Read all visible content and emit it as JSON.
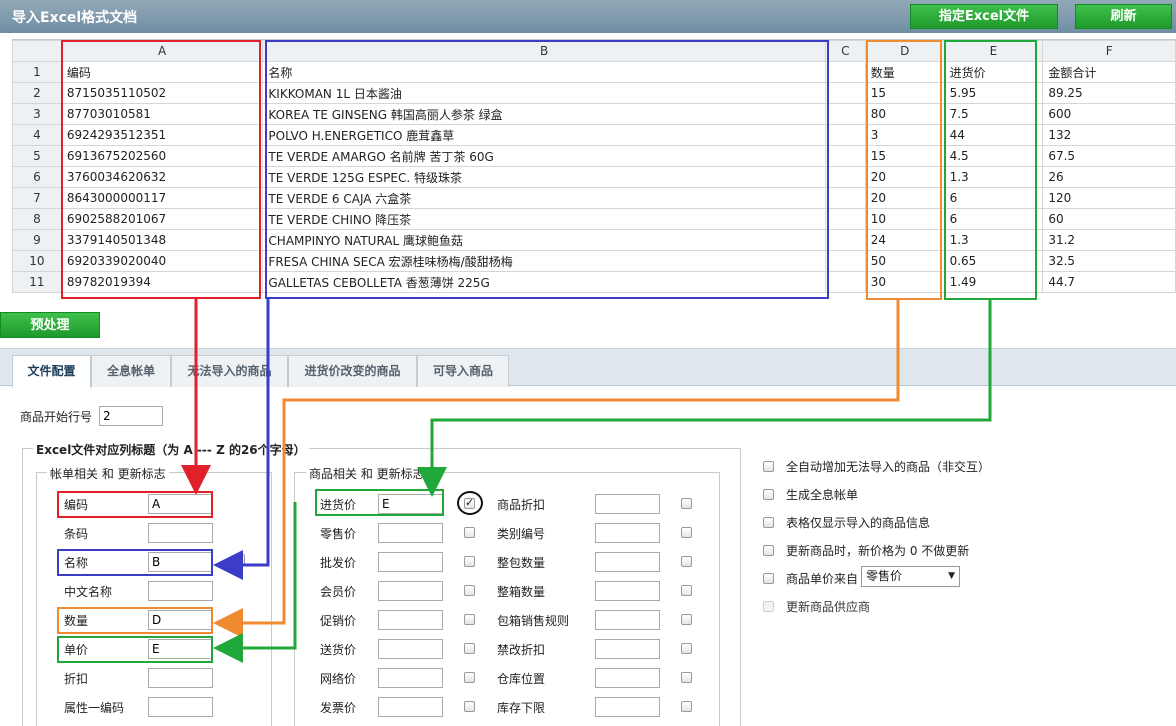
{
  "window_title": "导入Excel格式文档",
  "toolbar": {
    "specify_excel": "指定Excel文件",
    "refresh": "刷新"
  },
  "sheet": {
    "columns": [
      "A",
      "B",
      "C",
      "D",
      "E",
      "F"
    ],
    "rows": [
      {
        "n": "1",
        "a": "编码",
        "b": "名称",
        "c": "",
        "d": "数量",
        "e": "进货价",
        "f": "金额合计"
      },
      {
        "n": "2",
        "a": "8715035110502",
        "b": "KIKKOMAN 1L 日本酱油",
        "c": "",
        "d": "15",
        "e": "5.95",
        "f": "89.25"
      },
      {
        "n": "3",
        "a": "87703010581",
        "b": "KOREA TE GINSENG 韩国高丽人参茶 绿盒",
        "c": "",
        "d": "80",
        "e": "7.5",
        "f": "600"
      },
      {
        "n": "4",
        "a": "6924293512351",
        "b": "POLVO H.ENERGETICO 鹿茸鑫草",
        "c": "",
        "d": "3",
        "e": "44",
        "f": "132"
      },
      {
        "n": "5",
        "a": "6913675202560",
        "b": "TE VERDE AMARGO 名前牌 苦丁茶 60G",
        "c": "",
        "d": "15",
        "e": "4.5",
        "f": "67.5"
      },
      {
        "n": "6",
        "a": "3760034620632",
        "b": "TE VERDE 125G ESPEC. 特级珠茶",
        "c": "",
        "d": "20",
        "e": "1.3",
        "f": "26"
      },
      {
        "n": "7",
        "a": "8643000000117",
        "b": "TE VERDE 6 CAJA 六盒茶",
        "c": "",
        "d": "20",
        "e": "6",
        "f": "120"
      },
      {
        "n": "8",
        "a": "6902588201067",
        "b": "TE VERDE CHINO 降压茶",
        "c": "",
        "d": "10",
        "e": "6",
        "f": "60"
      },
      {
        "n": "9",
        "a": "3379140501348",
        "b": "CHAMPINYO NATURAL 鹰球鲍鱼菇",
        "c": "",
        "d": "24",
        "e": "1.3",
        "f": "31.2"
      },
      {
        "n": "10",
        "a": "6920339020040",
        "b": "FRESA CHINA SECA 宏源桂味杨梅/酸甜杨梅",
        "c": "",
        "d": "50",
        "e": "0.65",
        "f": "32.5"
      },
      {
        "n": "11",
        "a": "89782019394",
        "b": "GALLETAS CEBOLLETA 香葱薄饼 225G",
        "c": "",
        "d": "30",
        "e": "1.49",
        "f": "44.7"
      }
    ]
  },
  "preprocess_label": "预处理",
  "tabs": [
    "文件配置",
    "全息帐单",
    "无法导入的商品",
    "进货价改变的商品",
    "可导入商品"
  ],
  "start_row": {
    "label": "商品开始行号",
    "value": "2"
  },
  "excel_group_title": "Excel文件对应列标题（为 A --- Z 的26个字母）",
  "account_group": {
    "title": "帐单相关 和 更新标志",
    "fields": [
      {
        "label": "编码",
        "value": "A"
      },
      {
        "label": "条码",
        "value": ""
      },
      {
        "label": "名称",
        "value": "B"
      },
      {
        "label": "中文名称",
        "value": ""
      },
      {
        "label": "数量",
        "value": "D"
      },
      {
        "label": "单价",
        "value": "E"
      },
      {
        "label": "折扣",
        "value": ""
      },
      {
        "label": "属性一编码",
        "value": ""
      }
    ]
  },
  "product_group": {
    "title": "商品相关 和 更新标志",
    "left": [
      {
        "label": "进货价",
        "value": "E",
        "checked": true
      },
      {
        "label": "零售价",
        "value": "",
        "checked": false
      },
      {
        "label": "批发价",
        "value": "",
        "checked": false
      },
      {
        "label": "会员价",
        "value": "",
        "checked": false
      },
      {
        "label": "促销价",
        "value": "",
        "checked": false
      },
      {
        "label": "送货价",
        "value": "",
        "checked": false
      },
      {
        "label": "网络价",
        "value": "",
        "checked": false
      },
      {
        "label": "发票价",
        "value": "",
        "checked": false
      }
    ],
    "right": [
      {
        "label": "商品折扣",
        "value": ""
      },
      {
        "label": "类别编号",
        "value": ""
      },
      {
        "label": "整包数量",
        "value": ""
      },
      {
        "label": "整箱数量",
        "value": ""
      },
      {
        "label": "包箱销售规则",
        "value": ""
      },
      {
        "label": "禁改折扣",
        "value": ""
      },
      {
        "label": "仓库位置",
        "value": ""
      },
      {
        "label": "库存下限",
        "value": ""
      }
    ]
  },
  "options": [
    {
      "label": "全自动增加无法导入的商品（非交互）"
    },
    {
      "label": "生成全息帐单"
    },
    {
      "label": "表格仅显示导入的商品信息"
    },
    {
      "label": "更新商品时，新价格为 0 不做更新"
    },
    {
      "label": "商品单价来自"
    },
    {
      "label": "更新商品供应商"
    }
  ],
  "price_source_select": "零售价",
  "colors": {
    "red": "#e0202a",
    "blue": "#3b3cc8",
    "orange": "#f08a30",
    "green": "#21a83a",
    "button_green": "#1e9a2c"
  }
}
